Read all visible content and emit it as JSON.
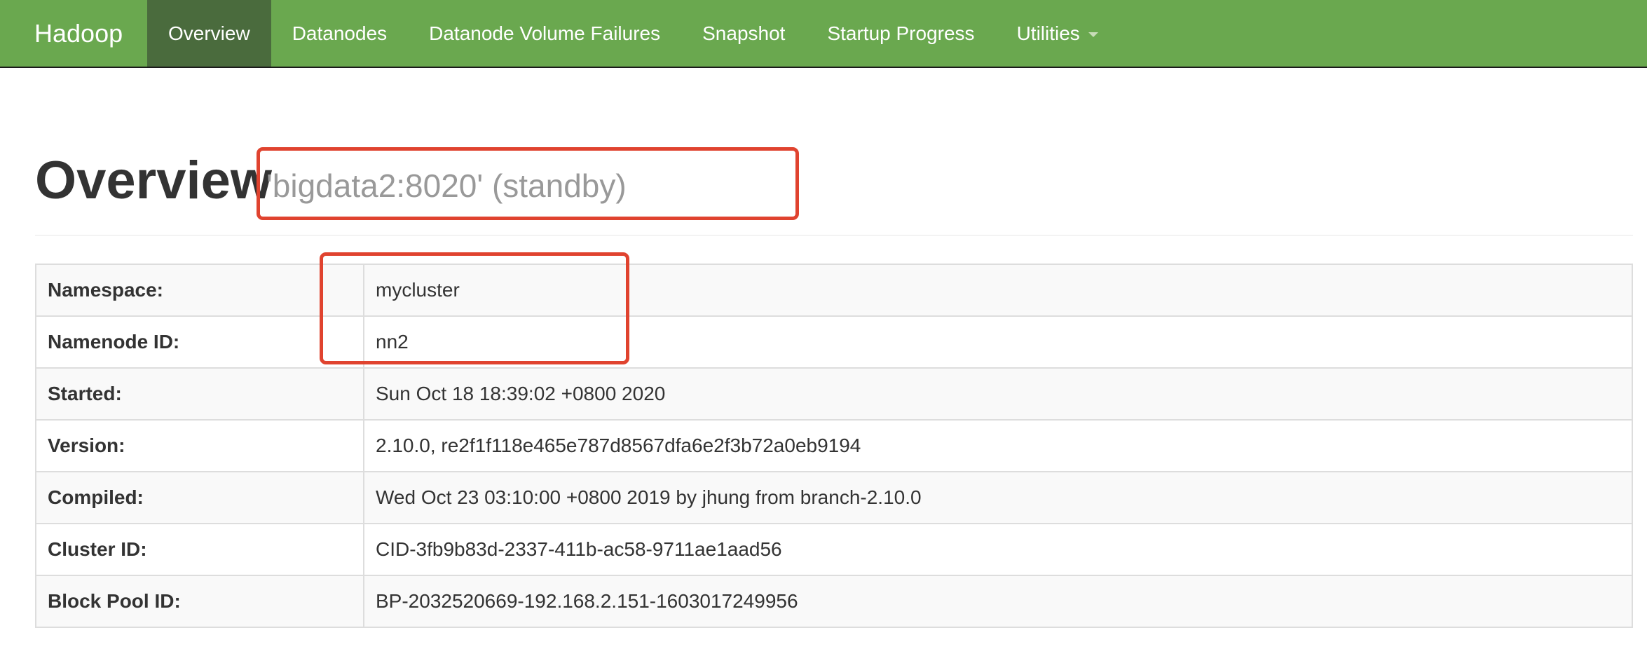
{
  "navbar": {
    "brand": "Hadoop",
    "items": [
      {
        "label": "Overview",
        "active": true
      },
      {
        "label": "Datanodes",
        "active": false
      },
      {
        "label": "Datanode Volume Failures",
        "active": false
      },
      {
        "label": "Snapshot",
        "active": false
      },
      {
        "label": "Startup Progress",
        "active": false
      },
      {
        "label": "Utilities",
        "active": false,
        "dropdown": true
      }
    ],
    "colors": {
      "background": "#6aa84f",
      "active_background": "#4a6b3d"
    }
  },
  "header": {
    "title": "Overview",
    "subtitle": "'bigdata2:8020' (standby)"
  },
  "overview_table": {
    "rows": [
      {
        "label": "Namespace:",
        "value": "mycluster"
      },
      {
        "label": "Namenode ID:",
        "value": "nn2"
      },
      {
        "label": "Started:",
        "value": "Sun Oct 18 18:39:02 +0800 2020"
      },
      {
        "label": "Version:",
        "value": "2.10.0, re2f1f118e465e787d8567dfa6e2f3b72a0eb9194"
      },
      {
        "label": "Compiled:",
        "value": "Wed Oct 23 03:10:00 +0800 2019 by jhung from branch-2.10.0"
      },
      {
        "label": "Cluster ID:",
        "value": "CID-3fb9b83d-2337-411b-ac58-9711ae1aad56"
      },
      {
        "label": "Block Pool ID:",
        "value": "BP-2032520669-192.168.2.151-1603017249956"
      }
    ]
  },
  "annotations": {
    "highlight_color": "#e0432f"
  }
}
